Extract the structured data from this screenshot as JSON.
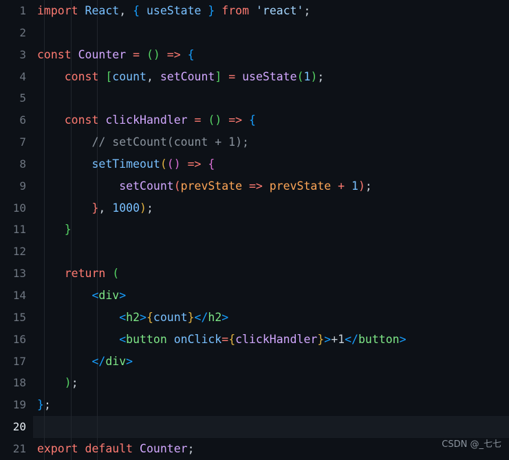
{
  "editor": {
    "language": "jsx",
    "background": "#0d1117",
    "active_line_background": "#161b22",
    "active_line": 20,
    "total_lines": 21,
    "line_numbers": [
      "1",
      "2",
      "3",
      "4",
      "5",
      "6",
      "7",
      "8",
      "9",
      "10",
      "11",
      "12",
      "13",
      "14",
      "15",
      "16",
      "17",
      "18",
      "19",
      "20",
      "21"
    ],
    "code_text": [
      "import React, { useState } from 'react';",
      "",
      "const Counter = () => {",
      "    const [count, setCount] = useState(1);",
      "",
      "    const clickHandler = () => {",
      "        // setCount(count + 1);",
      "        setTimeout(() => {",
      "            setCount(prevState => prevState + 1);",
      "        }, 1000);",
      "    }",
      "",
      "    return (",
      "        <div>",
      "            <h2>{count}</h2>",
      "            <button onClick={clickHandler}>+1</button>",
      "        </div>",
      "    );",
      "};",
      "",
      "export default Counter;"
    ]
  },
  "watermark": {
    "text": "CSDN @_七七"
  },
  "colors": {
    "keyword": "#ff7b72",
    "string": "#a5d6ff",
    "function": "#d2a8ff",
    "variable": "#79c0ff",
    "parameter": "#ffa657",
    "comment": "#8b949e",
    "tag": "#7ee787",
    "attribute": "#79c0ff",
    "number": "#79c0ff",
    "plain": "#c9d1d9",
    "gutter": "#6e7681",
    "gutter_active": "#e6edf3",
    "indent_guide": "#21262d"
  }
}
